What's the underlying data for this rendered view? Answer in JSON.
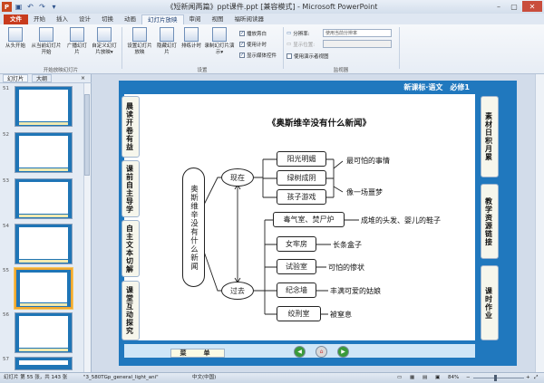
{
  "window": {
    "title": "《短新闻两篇》ppt课件.ppt [兼容模式] - Microsoft PowerPoint",
    "controls": [
      "–",
      "▢",
      "✕"
    ]
  },
  "ribbon": {
    "tabs": [
      "文件",
      "开始",
      "插入",
      "设计",
      "切换",
      "动画",
      "幻灯片放映",
      "审阅",
      "视图",
      "福昕阅读器"
    ],
    "active_tab": "幻灯片放映",
    "buttons": {
      "from_start": "从头开始",
      "from_current": "从当前幻灯片开始",
      "broadcast": "广播幻灯片",
      "custom_show": "自定义幻灯片放映▾",
      "setup_show": "设置幻灯片放映",
      "hide_slide": "隐藏幻灯片",
      "rehearse": "排练计时",
      "record": "录制幻灯片演示▾"
    },
    "checkboxes": {
      "play_narrations": "播放旁白",
      "use_timings": "使用计时",
      "show_media_controls": "显示媒体控件",
      "use_presenter_view": "使用演示者视图"
    },
    "monitor": {
      "resolution_label": "分辨率:",
      "resolution_value": "使用当前分辨率",
      "show_on_label": "显示位置:",
      "show_on_value": ""
    },
    "groups": {
      "start": "开始放映幻灯片",
      "setup": "设置",
      "monitors": "监视器"
    }
  },
  "left_panel": {
    "tabs": [
      "幻灯片",
      "大纲"
    ],
    "close": "×",
    "thumbnails": [
      {
        "num": "51"
      },
      {
        "num": "52"
      },
      {
        "num": "53"
      },
      {
        "num": "54"
      },
      {
        "num": "55",
        "selected": true
      },
      {
        "num": "56"
      },
      {
        "num": "57"
      }
    ]
  },
  "slide": {
    "header": "新课标·语文　必修1",
    "left_tabs": [
      "晨读开卷有益",
      "课前自主导学",
      "自主文本切解",
      "课堂互动探究"
    ],
    "right_tabs": [
      "素材日积月累",
      "教学资源链接",
      "课时作业"
    ],
    "title": "《奥斯维辛没有什么新闻》",
    "root_label": "奥斯维辛没有什么新闻",
    "now": {
      "label": "现在",
      "items": [
        "阳光明媚",
        "绿树成阴",
        "孩子游戏"
      ],
      "results": [
        "最可怕的事情",
        "像一场噩梦"
      ]
    },
    "past": {
      "label": "过去",
      "items": [
        "毒气室、焚尸炉",
        "女牢房",
        "试验室",
        "纪念墙",
        "绞刑室"
      ],
      "results": [
        "成堆的头发、婴儿的鞋子",
        "长条盒子",
        "可怕的惨状",
        "丰满可爱的姑娘",
        "被窒息"
      ]
    },
    "menu_label": "菜　单",
    "nav_buttons": [
      "back",
      "home",
      "forward"
    ]
  },
  "status": {
    "slide_pos": "幻灯片 第 55 张，共 143 张",
    "theme": "\"3_580TGp_general_light_ani\"",
    "language": "中文(中国)",
    "zoom": "84%",
    "zoom_fraction": 0.84
  }
}
